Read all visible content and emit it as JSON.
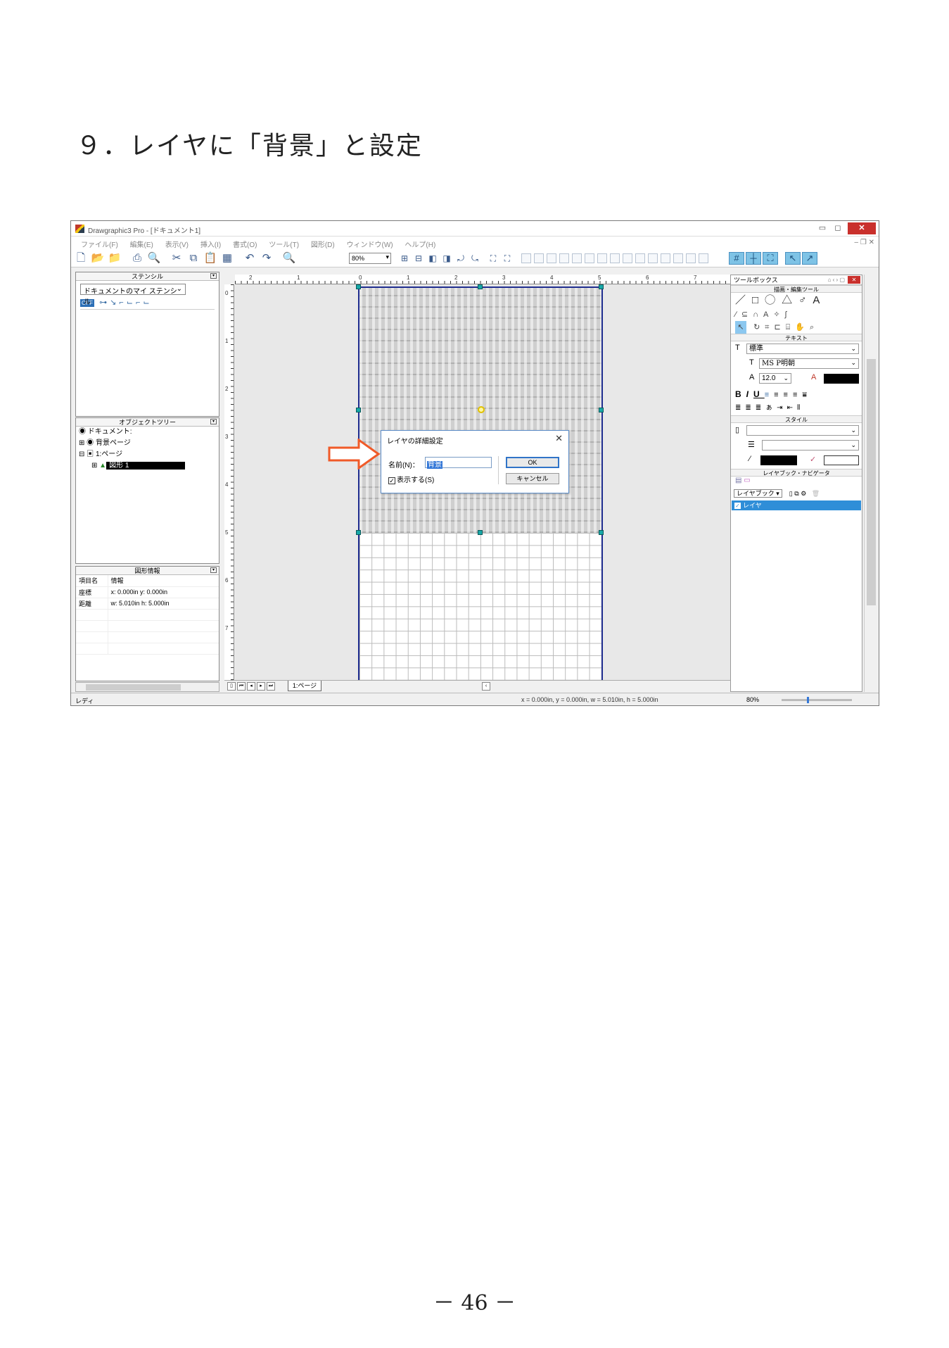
{
  "doc": {
    "heading": "９．レイヤに「背景」と設定",
    "page_number": "－ 46 －"
  },
  "app": {
    "title": "Drawgraphic3 Pro - [ドキュメント1]",
    "menu": [
      "ファイル(F)",
      "編集(E)",
      "表示(V)",
      "挿入(I)",
      "書式(O)",
      "ツール(T)",
      "図形(D)",
      "ウィンドウ(W)",
      "ヘルプ(H)"
    ],
    "zoom": "80%",
    "status": "レディ",
    "coords": "x = 0.000in, y = 0.000in, w = 5.010in, h = 5.000in",
    "status_zoom": "80%"
  },
  "stencil": {
    "title": "ステンシル",
    "selected": "ドキュメントのマイ ステンシル",
    "off_label": "OFF"
  },
  "tree": {
    "title": "オブジェクトツリー",
    "root": "ドキュメント:",
    "bg_page": "背景ページ",
    "page1": "1:ページ",
    "shape1": "図形 1"
  },
  "info": {
    "title": "図形情報",
    "header": [
      "項目名",
      "情報"
    ],
    "rows": [
      {
        "key": "座標",
        "value": "x: 0.000in y: 0.000in"
      },
      {
        "key": "距離",
        "value": "w: 5.010in h: 5.000in"
      }
    ]
  },
  "ruler": {
    "h_ticks": [
      "2",
      "1",
      "0",
      "1",
      "2",
      "3",
      "4",
      "5",
      "6",
      "7"
    ],
    "v_ticks": [
      "0",
      "1",
      "2",
      "3",
      "4",
      "5",
      "6",
      "7"
    ]
  },
  "pagetab": {
    "label": "1:ページ"
  },
  "dialog": {
    "title": "レイヤの詳細設定",
    "name_label": "名前(N)：",
    "name_value": "背景",
    "visible_label": "表示する(S)",
    "visible_checked": true,
    "ok": "OK",
    "cancel": "キャンセル"
  },
  "toolbox": {
    "title": "ツールボックス",
    "sec_draw": "描画・編集ツール",
    "sec_text": "テキスト",
    "sec_style": "スタイル",
    "sec_layer": "レイヤブック・ナビゲータ",
    "text_style": "標準",
    "font": "MS P明朝",
    "font_size": "12.0",
    "layerbook": "レイヤブック",
    "layer_name": "レイヤ"
  },
  "colors": {
    "accent": "#2f8ed8",
    "arrow": "#f05a28",
    "page_border": "#1f2d8f"
  }
}
